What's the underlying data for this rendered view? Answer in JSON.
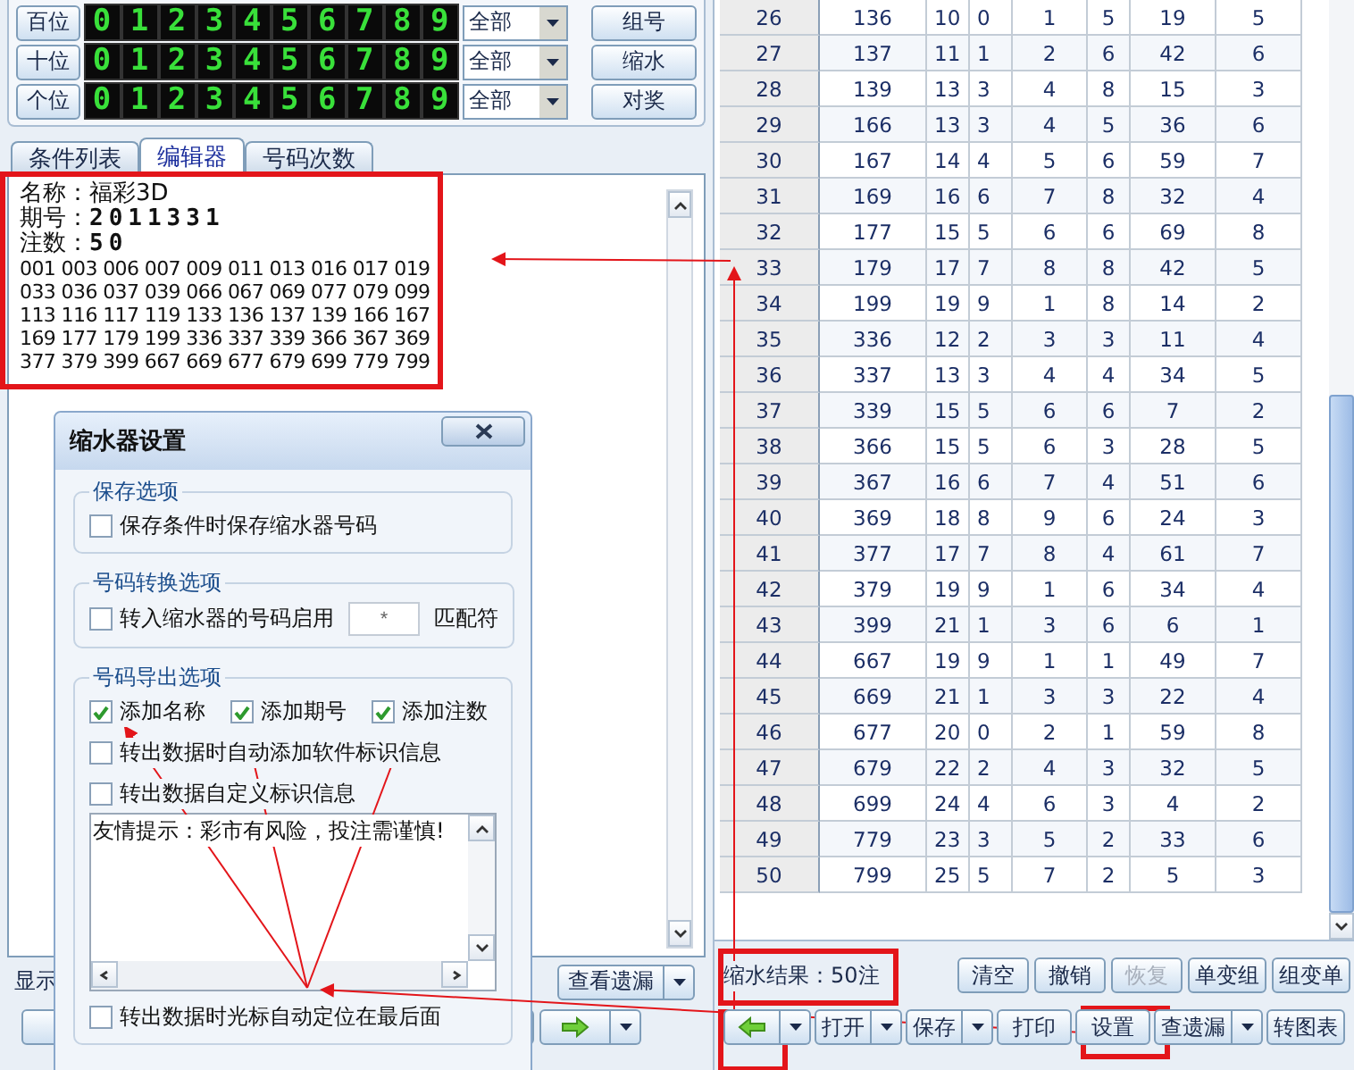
{
  "control_panel": {
    "rows": [
      {
        "label": "百位",
        "digits": [
          "0",
          "1",
          "2",
          "3",
          "4",
          "5",
          "6",
          "7",
          "8",
          "9"
        ],
        "filter": "全部",
        "action": "组号"
      },
      {
        "label": "十位",
        "digits": [
          "0",
          "1",
          "2",
          "3",
          "4",
          "5",
          "6",
          "7",
          "8",
          "9"
        ],
        "filter": "全部",
        "action": "缩水"
      },
      {
        "label": "个位",
        "digits": [
          "0",
          "1",
          "2",
          "3",
          "4",
          "5",
          "6",
          "7",
          "8",
          "9"
        ],
        "filter": "全部",
        "action": "对奖"
      }
    ]
  },
  "tabs": [
    {
      "label": "条件列表",
      "selected": false
    },
    {
      "label": "编辑器",
      "selected": true
    },
    {
      "label": "号码次数",
      "selected": false
    }
  ],
  "editor": {
    "lines": [
      {
        "kind": "header",
        "text": "名称：福彩3D"
      },
      {
        "kind": "header",
        "text": "期号：**2011331**"
      },
      {
        "kind": "header",
        "text": "注数：**50**"
      },
      {
        "kind": "numbers",
        "text": "001 003 006 007 009 011 013 016 017 019"
      },
      {
        "kind": "numbers",
        "text": "033 036 037 039 066 067 069 077 079 099"
      },
      {
        "kind": "numbers",
        "text": "113 116 117 119 133 136 137 139 166 167"
      },
      {
        "kind": "numbers",
        "text": "169 177 179 199 336 337 339 366 367 369"
      },
      {
        "kind": "numbers",
        "text": "377 379 399 667 669 677 679 699 779 799"
      }
    ]
  },
  "left_footer": {
    "label": "显示",
    "button": "查看遗漏"
  },
  "left_toolbar": [
    {
      "kind": "blank-split"
    },
    {
      "kind": "arrow-split"
    }
  ],
  "table": {
    "rows": [
      [
        "26",
        "136",
        "10",
        "0",
        "1",
        "5",
        "19",
        "5"
      ],
      [
        "27",
        "137",
        "11",
        "1",
        "2",
        "6",
        "42",
        "6"
      ],
      [
        "28",
        "139",
        "13",
        "3",
        "4",
        "8",
        "15",
        "3"
      ],
      [
        "29",
        "166",
        "13",
        "3",
        "4",
        "5",
        "36",
        "6"
      ],
      [
        "30",
        "167",
        "14",
        "4",
        "5",
        "6",
        "59",
        "7"
      ],
      [
        "31",
        "169",
        "16",
        "6",
        "7",
        "8",
        "32",
        "4"
      ],
      [
        "32",
        "177",
        "15",
        "5",
        "6",
        "6",
        "69",
        "8"
      ],
      [
        "33",
        "179",
        "17",
        "7",
        "8",
        "8",
        "42",
        "5"
      ],
      [
        "34",
        "199",
        "19",
        "9",
        "1",
        "8",
        "14",
        "2"
      ],
      [
        "35",
        "336",
        "12",
        "2",
        "3",
        "3",
        "11",
        "4"
      ],
      [
        "36",
        "337",
        "13",
        "3",
        "4",
        "4",
        "34",
        "5"
      ],
      [
        "37",
        "339",
        "15",
        "5",
        "6",
        "6",
        "7",
        "2"
      ],
      [
        "38",
        "366",
        "15",
        "5",
        "6",
        "3",
        "28",
        "5"
      ],
      [
        "39",
        "367",
        "16",
        "6",
        "7",
        "4",
        "51",
        "6"
      ],
      [
        "40",
        "369",
        "18",
        "8",
        "9",
        "6",
        "24",
        "3"
      ],
      [
        "41",
        "377",
        "17",
        "7",
        "8",
        "4",
        "61",
        "7"
      ],
      [
        "42",
        "379",
        "19",
        "9",
        "1",
        "6",
        "34",
        "4"
      ],
      [
        "43",
        "399",
        "21",
        "1",
        "3",
        "6",
        "6",
        "1"
      ],
      [
        "44",
        "667",
        "19",
        "9",
        "1",
        "1",
        "49",
        "7"
      ],
      [
        "45",
        "669",
        "21",
        "1",
        "3",
        "3",
        "22",
        "4"
      ],
      [
        "46",
        "677",
        "20",
        "0",
        "2",
        "1",
        "59",
        "8"
      ],
      [
        "47",
        "679",
        "22",
        "2",
        "4",
        "3",
        "32",
        "5"
      ],
      [
        "48",
        "699",
        "24",
        "4",
        "6",
        "3",
        "4",
        "2"
      ],
      [
        "49",
        "779",
        "23",
        "3",
        "5",
        "2",
        "33",
        "6"
      ],
      [
        "50",
        "799",
        "25",
        "5",
        "7",
        "2",
        "5",
        "3"
      ]
    ]
  },
  "result": "缩水结果：50注",
  "edit_buttons": [
    {
      "label": "清空",
      "disabled": false
    },
    {
      "label": "撤销",
      "disabled": false
    },
    {
      "label": "恢复",
      "disabled": true
    },
    {
      "label": "单变组",
      "disabled": false
    },
    {
      "label": "组变单",
      "disabled": false
    }
  ],
  "toolbar": [
    {
      "kind": "arrow-split"
    },
    {
      "kind": "split",
      "label": "打开"
    },
    {
      "kind": "split",
      "label": "保存"
    },
    {
      "kind": "button",
      "label": "打印"
    },
    {
      "kind": "button",
      "label": "设置"
    },
    {
      "kind": "split",
      "label": "查遗漏"
    },
    {
      "kind": "button",
      "label": "转图表"
    }
  ],
  "dialog": {
    "title": "缩水器设置",
    "groups": [
      {
        "title": "保存选项",
        "options": [
          {
            "kind": "checkbox",
            "label": "保存条件时保存缩水器号码",
            "checked": false
          }
        ]
      },
      {
        "title": "号码转换选项",
        "options": [
          {
            "kind": "checkbox-field",
            "label": "转入缩水器的号码启用",
            "checked": false,
            "value": "*",
            "suffix": "匹配符"
          }
        ]
      },
      {
        "title": "号码导出选项",
        "options": [
          {
            "kind": "checkbox-row",
            "items": [
              {
                "label": "添加名称",
                "checked": true
              },
              {
                "label": "添加期号",
                "checked": true
              },
              {
                "label": "添加注数",
                "checked": true
              }
            ]
          },
          {
            "kind": "checkbox",
            "label": "转出数据时自动添加软件标识信息",
            "checked": false
          },
          {
            "kind": "checkbox",
            "label": "转出数据自定义标识信息",
            "checked": false
          },
          {
            "kind": "textarea",
            "value": "友情提示：彩市有风险，投注需谨慎!"
          },
          {
            "kind": "checkbox",
            "label": "转出数据时光标自动定位在最后面",
            "checked": false
          }
        ]
      }
    ]
  }
}
